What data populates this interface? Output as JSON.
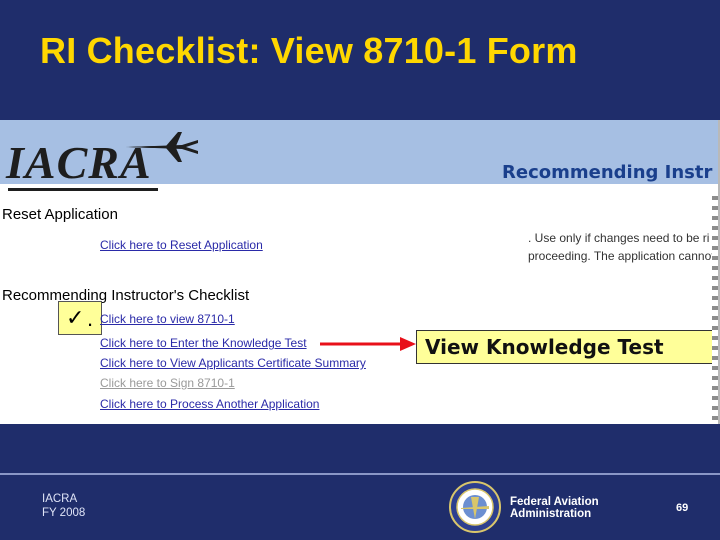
{
  "slide": {
    "title": "RI Checklist: View 8710-1 Form",
    "footer_left_line1": "IACRA",
    "footer_left_line2": "FY 2008",
    "footer_org_line1": "Federal Aviation",
    "footer_org_line2": "Administration",
    "page_number": "69"
  },
  "app": {
    "logo_text": "IACRA",
    "header_title": "Recommending Instr",
    "reset_section": {
      "heading": "Reset Application",
      "link": "Click here to Reset Application",
      "note_line1": ". Use only if changes need to be ri",
      "note_line2": "proceeding. The application cannot"
    },
    "checklist": {
      "heading": "Recommending Instructor's Checklist",
      "check_mark": "✓",
      "check_dot": ".",
      "items": [
        {
          "label": "Click here to view 8710-1",
          "enabled": true
        },
        {
          "label": "Click here to Enter the Knowledge Test",
          "enabled": true
        },
        {
          "label": "Click here to View Applicants Certificate Summary",
          "enabled": true
        },
        {
          "label": "Click here to Sign 8710-1",
          "enabled": false
        },
        {
          "label": "Click here to Process Another Application",
          "enabled": true
        }
      ]
    },
    "callout": "View Knowledge Test"
  },
  "colors": {
    "slide_bg": "#1f2d6b",
    "title": "#ffd700",
    "header_band": "#a6bfe3",
    "link": "#2a2aa8",
    "highlight": "#ffff99",
    "arrow": "#e8101a"
  },
  "icons": {
    "logo_plane": "airplane-icon",
    "seal": "faa-seal-icon",
    "arrow": "red-arrow-icon",
    "check": "check-mark-icon"
  }
}
